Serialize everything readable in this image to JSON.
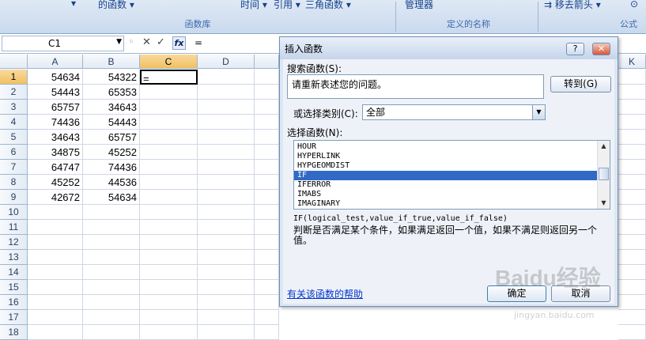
{
  "ribbon": {
    "items": [
      "的函数",
      "时间",
      "引用",
      "三角函数",
      "管理器",
      "移去箭头",
      "公式"
    ],
    "group_labels": [
      "函数库",
      "定义的名称"
    ]
  },
  "formula_bar": {
    "name_box": "C1",
    "cancel_icon": "✕",
    "enter_icon": "✓",
    "fx_label": "fx",
    "equals": "=",
    "value": ""
  },
  "sheet": {
    "columns": [
      "A",
      "B",
      "C",
      "D",
      "K"
    ],
    "rows": [
      "1",
      "2",
      "3",
      "4",
      "5",
      "6",
      "7",
      "8",
      "9",
      "10",
      "11",
      "12",
      "13",
      "14",
      "15",
      "16",
      "17",
      "18"
    ],
    "colA": [
      "54634",
      "54443",
      "65757",
      "74436",
      "34643",
      "34875",
      "64747",
      "45252",
      "42672"
    ],
    "colB": [
      "54322",
      "65353",
      "34643",
      "54443",
      "65757",
      "45252",
      "74436",
      "44536",
      "54634"
    ],
    "active_cell_value": "="
  },
  "dialog": {
    "title": "插入函数",
    "help_btn": "?",
    "close_btn": "✕",
    "search_label": "搜索函数(S):",
    "search_text": "请重新表述您的问题。",
    "goto_btn": "转到(G)",
    "category_label": "或选择类别(C):",
    "category_value": "全部",
    "select_label": "选择函数(N):",
    "functions": [
      "HOUR",
      "HYPERLINK",
      "HYPGEOMDIST",
      "IF",
      "IFERROR",
      "IMABS",
      "IMAGINARY"
    ],
    "selected_function": "IF",
    "signature": "IF(logical_test,value_if_true,value_if_false)",
    "description": "判断是否满足某个条件，如果满足返回一个值，如果不满足则返回另一个值。",
    "help_link": "有关该函数的帮助",
    "ok_btn": "确定",
    "cancel_btn": "取消"
  },
  "watermark": {
    "logo": "Baidu经验",
    "url": "jingyan.baidu.com"
  }
}
